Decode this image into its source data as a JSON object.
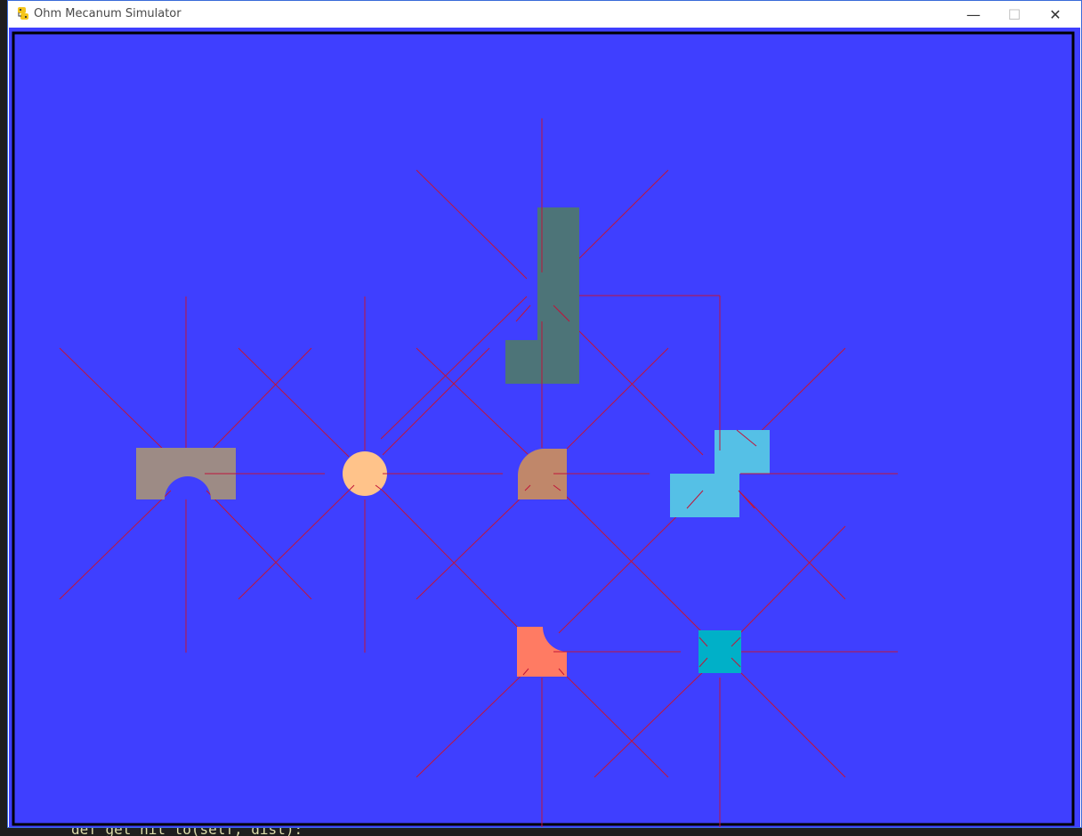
{
  "window": {
    "title": "Ohm Mecanum Simulator",
    "controls": {
      "minimize": "—",
      "maximize": "☐",
      "close": "✕"
    }
  },
  "editor": {
    "visible_code_fragment": "def get_hit_to(self, dist):"
  },
  "colors": {
    "background": "#3f3fff",
    "border": "#000000",
    "ray": "#c0153a",
    "robot_tall_l": "#4d7478",
    "robot_arch": "#9d8b85",
    "robot_circle": "#ffc38a",
    "robot_notch": "#c0876a",
    "robot_cross": "#55c0e6",
    "robot_corner": "#ff7b63",
    "robot_square": "#00b0c8"
  },
  "icons": {
    "app": "python-snake-icon"
  }
}
